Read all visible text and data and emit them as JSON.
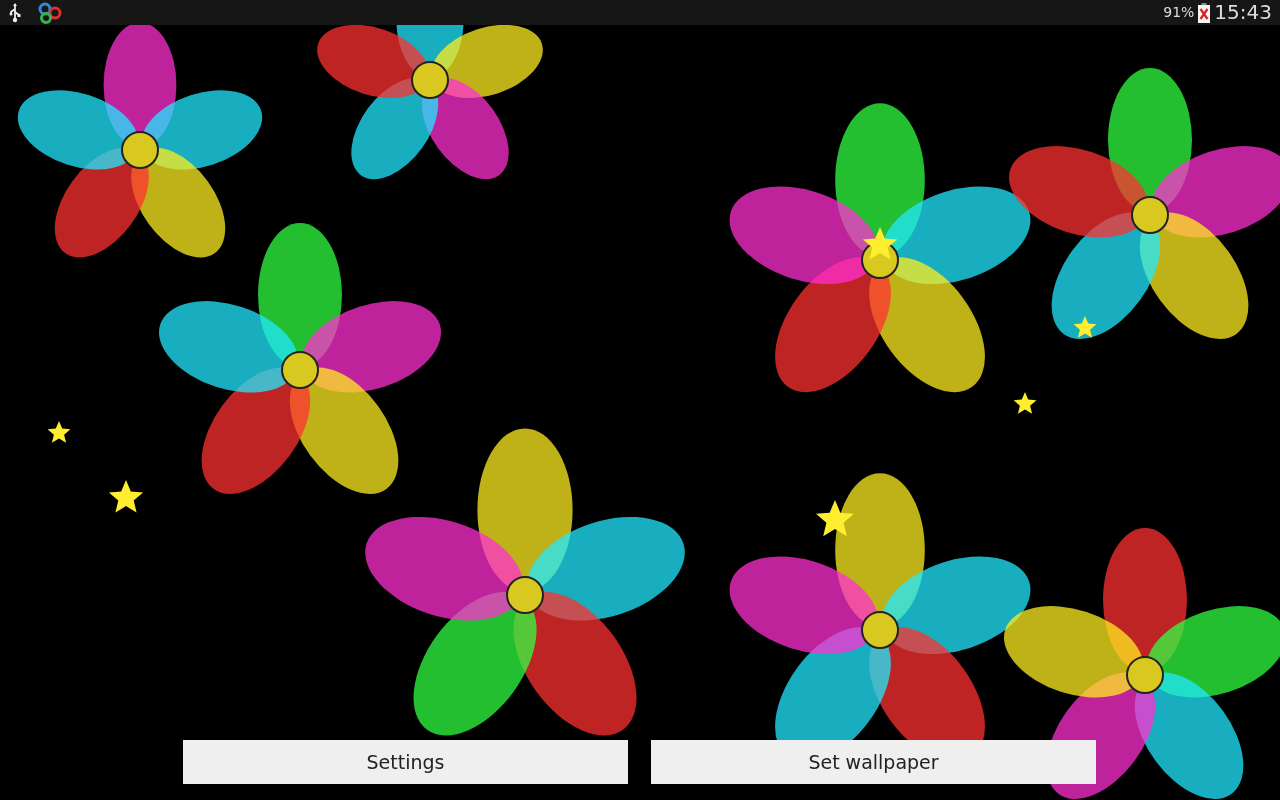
{
  "status_bar": {
    "battery": "91%",
    "time": "15:43"
  },
  "buttons": [
    {
      "label": "Settings"
    },
    {
      "label": "Set wallpaper"
    }
  ]
}
